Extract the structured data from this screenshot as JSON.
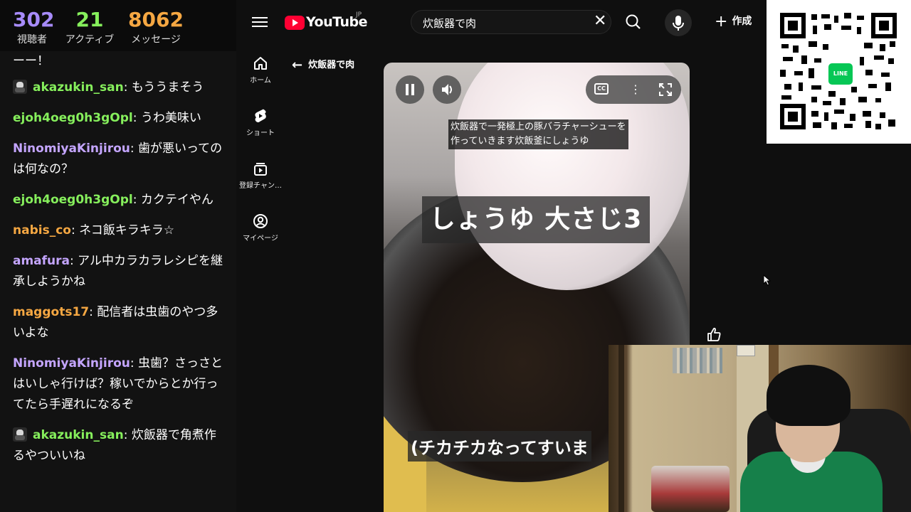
{
  "stream_stats": [
    {
      "value": "302",
      "label": "視聴者",
      "color": "#a78bfa"
    },
    {
      "value": "21",
      "label": "アクティブ",
      "color": "#86ef5c"
    },
    {
      "value": "8062",
      "label": "メッセージ",
      "color": "#f5a742"
    }
  ],
  "chat": {
    "partial_top": "ーー！",
    "messages": [
      {
        "user": "akazukin_san",
        "text": "もううまそう",
        "color": "#86ef5c",
        "avatar": true
      },
      {
        "user": "ejoh4oeg0h3gOpl",
        "text": "うわ美味い",
        "color": "#86ef5c",
        "avatar": false
      },
      {
        "user": "NinomiyaKinjirou",
        "text": "歯が悪いってのは何なの？",
        "color": "#c4a5ff",
        "avatar": false
      },
      {
        "user": "ejoh4oeg0h3gOpl",
        "text": "カクテイやん",
        "color": "#86ef5c",
        "avatar": false
      },
      {
        "user": "nabis_co",
        "text": "ネコ飯キラキラ☆",
        "color": "#f5a742",
        "avatar": false
      },
      {
        "user": "amafura",
        "text": "アル中カラカラレシピを継承しようかね",
        "color": "#c4a5ff",
        "avatar": false
      },
      {
        "user": "maggots17",
        "text": "配信者は虫歯のやつ多いよな",
        "color": "#f5a742",
        "avatar": false
      },
      {
        "user": "NinomiyaKinjirou",
        "text": "虫歯？さっさとはいしゃ行けば？稼いでからとか行ってたら手遅れになるぞ",
        "color": "#c4a5ff",
        "avatar": false
      },
      {
        "user": "akazukin_san",
        "text": "炊飯器で角煮作るやついいね",
        "color": "#86ef5c",
        "avatar": true
      }
    ]
  },
  "youtube": {
    "logo_text": "YouTube",
    "region": "JP",
    "search": {
      "value": "炊飯器で肉"
    },
    "create_label": "作成",
    "nav": [
      {
        "label": "ホーム",
        "icon": "home-icon"
      },
      {
        "label": "ショート",
        "icon": "shorts-icon"
      },
      {
        "label": "登録チャン…",
        "icon": "subscriptions-icon"
      },
      {
        "label": "マイページ",
        "icon": "account-icon"
      }
    ],
    "back_label": "炊飯器で肉",
    "video": {
      "subtitle_lines": [
        "炊飯器で一発極上の豚バラチャーシューを",
        "作っていきます炊飯釜にしょうゆ"
      ],
      "caption_big": "しょうゆ 大さじ3",
      "caption_bottom": "(チカチカなってすいま",
      "cc_label": "CC"
    }
  },
  "qr": {
    "badge": "LINE"
  }
}
